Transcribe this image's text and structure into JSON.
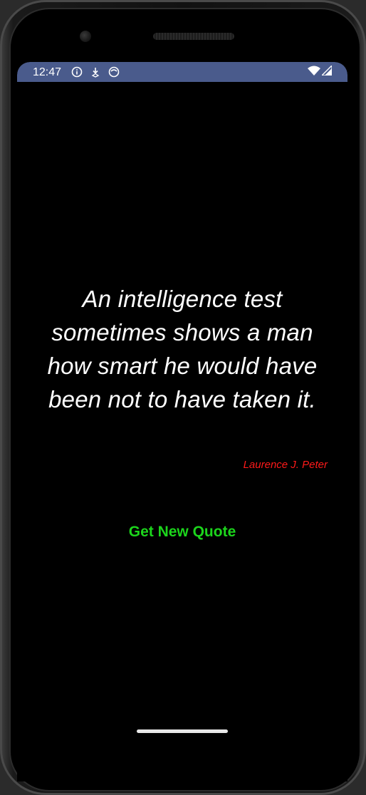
{
  "status_bar": {
    "time": "12:47",
    "left_icons": [
      "info-icon",
      "download-icon",
      "emoji-icon"
    ],
    "right_icons": [
      "wifi-icon",
      "cell-signal-icon"
    ],
    "color": "#4a5b8c"
  },
  "quote": {
    "text": "An intelligence test sometimes shows a man how smart he would have been not to have taken it.",
    "author": "Laurence J. Peter",
    "text_color": "#ffffff",
    "author_color": "#ff1a1a"
  },
  "actions": {
    "new_quote_label": "Get New Quote",
    "button_color": "#1cd51c"
  }
}
